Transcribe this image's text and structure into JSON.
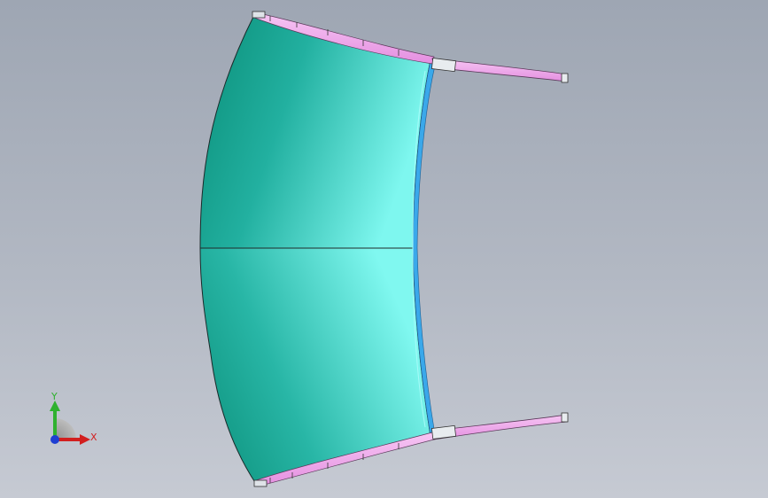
{
  "viewport": {
    "background_top": "#9ea6b3",
    "background_bottom": "#c6cad3"
  },
  "model": {
    "body_color_dark": "#0b8f78",
    "body_color_light": "#79f5ee",
    "band_color": "#f1a6ee",
    "edge_band_color": "#2f9de0"
  },
  "triad": {
    "x_label": "X",
    "y_label": "Y",
    "x_color": "#d21f1f",
    "y_color": "#2fb12f",
    "z_color": "#1f3fd2"
  }
}
